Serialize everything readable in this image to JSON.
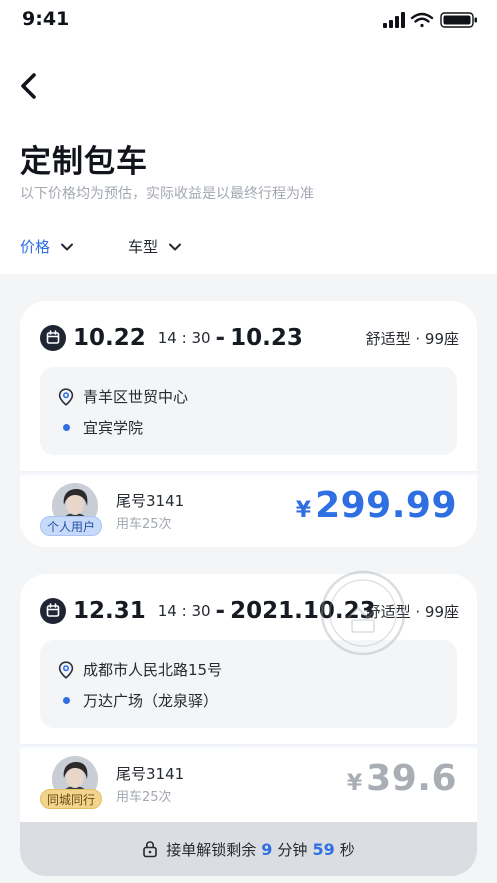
{
  "status_bar": {
    "time": "9:41"
  },
  "header": {
    "title": "定制包车",
    "subtitle": "以下价格均为预估，实际收益是以最终行程为准"
  },
  "filters": [
    {
      "label": "价格",
      "active": true
    },
    {
      "label": "车型",
      "active": false
    }
  ],
  "orders": [
    {
      "date_start": "10.22",
      "time": "14 : 30",
      "date_end": "10.23",
      "car_type": "舒适型 · 99座",
      "from": "青羊区世贸中心",
      "to": "宜宾学院",
      "user_badge": "个人用户",
      "tail_number": "尾号3141",
      "use_count": "用车25次",
      "currency": "¥",
      "price": "299.99"
    },
    {
      "date_start": "12.31",
      "time": "14 : 30",
      "date_end": "2021.10.23",
      "car_type": "舒适型 · 99座",
      "from": "成都市人民北路15号",
      "to": "万达广场（龙泉驿）",
      "user_badge": "同城同行",
      "tail_number": "尾号3141",
      "use_count": "用车25次",
      "currency": "¥",
      "price": "39.6",
      "lock": {
        "prefix": "接单解锁剩余",
        "minutes": "9",
        "min_unit": "分钟",
        "seconds": "59",
        "sec_unit": "秒"
      }
    }
  ],
  "colors": {
    "accent": "#2f6fe2",
    "muted": "#a3a8b1",
    "background": "#f4f5f7"
  }
}
